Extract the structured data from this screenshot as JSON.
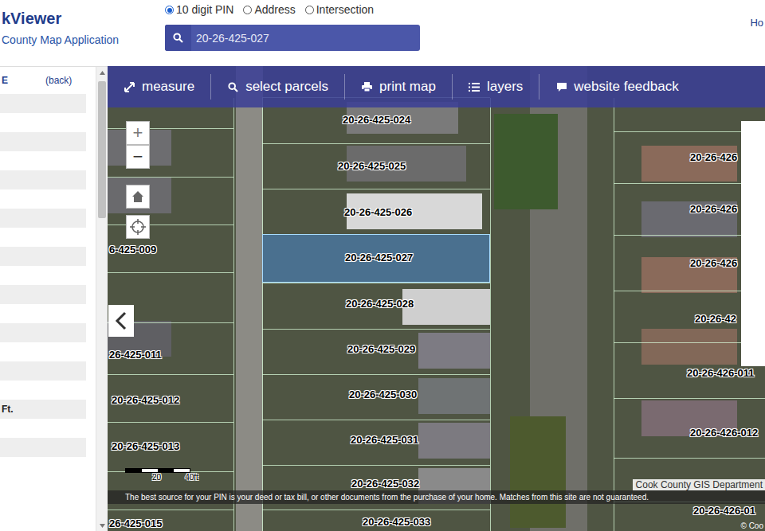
{
  "app": {
    "title": "kViewer",
    "subtitle": "County Map Application",
    "home_link": "Ho"
  },
  "search_modes": [
    {
      "label": "10 digit PIN",
      "selected": true
    },
    {
      "label": "Address",
      "selected": false
    },
    {
      "label": "Intersection",
      "selected": false
    }
  ],
  "search": {
    "value": "20-26-425-027"
  },
  "sidebar": {
    "header": "E",
    "back": "(back)",
    "unit_label": "Ft."
  },
  "toolbar": [
    {
      "label": "measure"
    },
    {
      "label": "select parcels"
    },
    {
      "label": "print map"
    },
    {
      "label": "layers"
    },
    {
      "label": "website feedback"
    }
  ],
  "map_controls": {
    "zoom_in": "+",
    "zoom_out": "−"
  },
  "parcels": [
    {
      "pin": "20-26-425-024",
      "selected": false
    },
    {
      "pin": "20-26-425-025",
      "selected": false
    },
    {
      "pin": "20-26-425-026",
      "selected": false
    },
    {
      "pin": "20-26-425-027",
      "selected": true
    },
    {
      "pin": "20-26-425-028",
      "selected": false
    },
    {
      "pin": "20-26-425-029",
      "selected": false
    },
    {
      "pin": "20-26-425-030",
      "selected": false
    },
    {
      "pin": "20-26-425-031",
      "selected": false
    },
    {
      "pin": "20-26-425-032",
      "selected": false
    },
    {
      "pin": "20-26-425-033",
      "selected": false
    },
    {
      "pin": "6-425-009",
      "selected": false
    },
    {
      "pin": "26-425-011",
      "selected": false
    },
    {
      "pin": "20-26-425-012",
      "selected": false
    },
    {
      "pin": "20-26-425-013",
      "selected": false
    },
    {
      "pin": "26-425-015",
      "selected": false
    },
    {
      "pin": "20-26-426",
      "selected": false
    },
    {
      "pin": "20-26-426",
      "selected": false
    },
    {
      "pin": "20-26-426",
      "selected": false
    },
    {
      "pin": "20-26-42",
      "selected": false
    },
    {
      "pin": "20-26-426-011",
      "selected": false
    },
    {
      "pin": "20-26-426-012",
      "selected": false
    },
    {
      "pin": "20-26-426-01",
      "selected": false
    }
  ],
  "scale": {
    "labels": [
      "20",
      "40ft"
    ]
  },
  "disclaimer": "The best source for your PIN is your deed or tax bill, or other documents from the purchase of your home. Matches from this site are not guaranteed.",
  "attribution": "Cook County GIS Department",
  "copyright": "© Coo"
}
